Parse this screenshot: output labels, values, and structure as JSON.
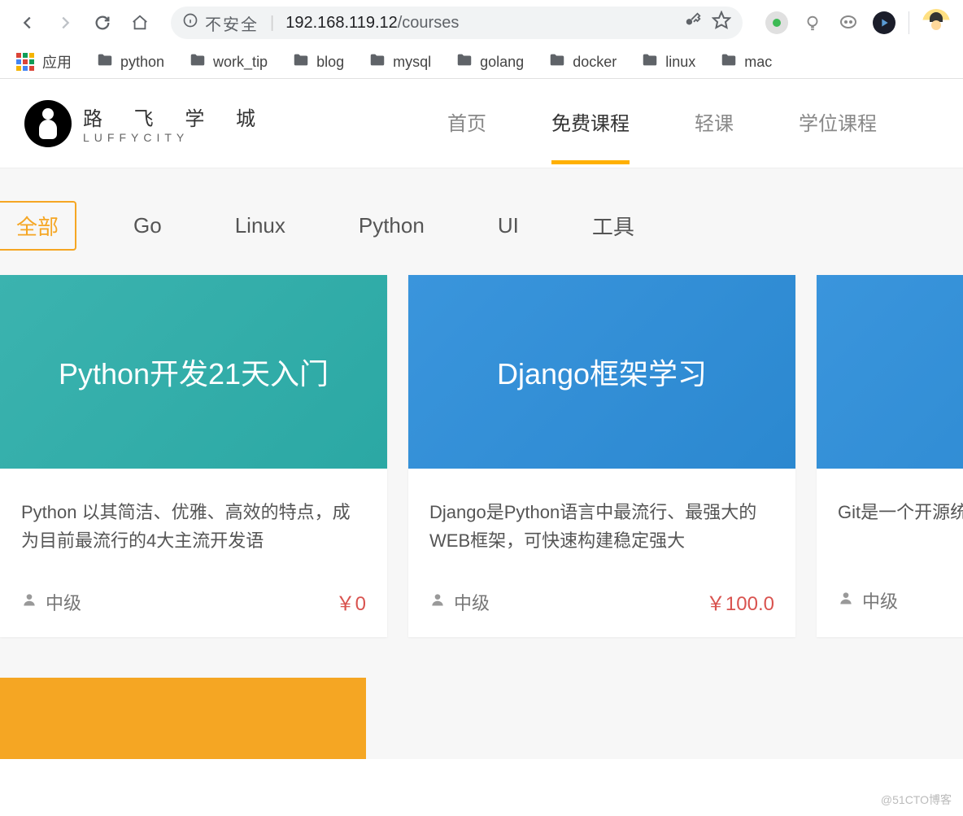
{
  "browser": {
    "insecure_label": "不安全",
    "url_host": "192.168.119.12",
    "url_path": "/courses",
    "apps_label": "应用",
    "bookmarks": [
      "python",
      "work_tip",
      "blog",
      "mysql",
      "golang",
      "docker",
      "linux",
      "mac"
    ]
  },
  "site": {
    "logo_cn": "路 飞 学 城",
    "logo_en": "LUFFYCITY",
    "nav": [
      "首页",
      "免费课程",
      "轻课",
      "学位课程"
    ],
    "nav_active_index": 1
  },
  "filters": {
    "tabs": [
      "全部",
      "Go",
      "Linux",
      "Python",
      "UI",
      "工具"
    ],
    "active_index": 0
  },
  "courses": [
    {
      "title": "Python开发21天入门",
      "desc": "Python 以其简洁、优雅、高效的特点，成为目前最流行的4大主流开发语",
      "level": "中级",
      "price": "￥0",
      "hero_class": "hero-teal"
    },
    {
      "title": "Django框架学习",
      "desc": "Django是Python语言中最流行、最强大的WEB框架，可快速构建稳定强大",
      "level": "中级",
      "price": "￥100.0",
      "hero_class": "hero-blue"
    },
    {
      "title": "",
      "desc": "Git是一个开源统，可以有效",
      "level": "中级",
      "price": "",
      "hero_class": "hero-blue"
    }
  ],
  "watermark": "@51CTO博客"
}
